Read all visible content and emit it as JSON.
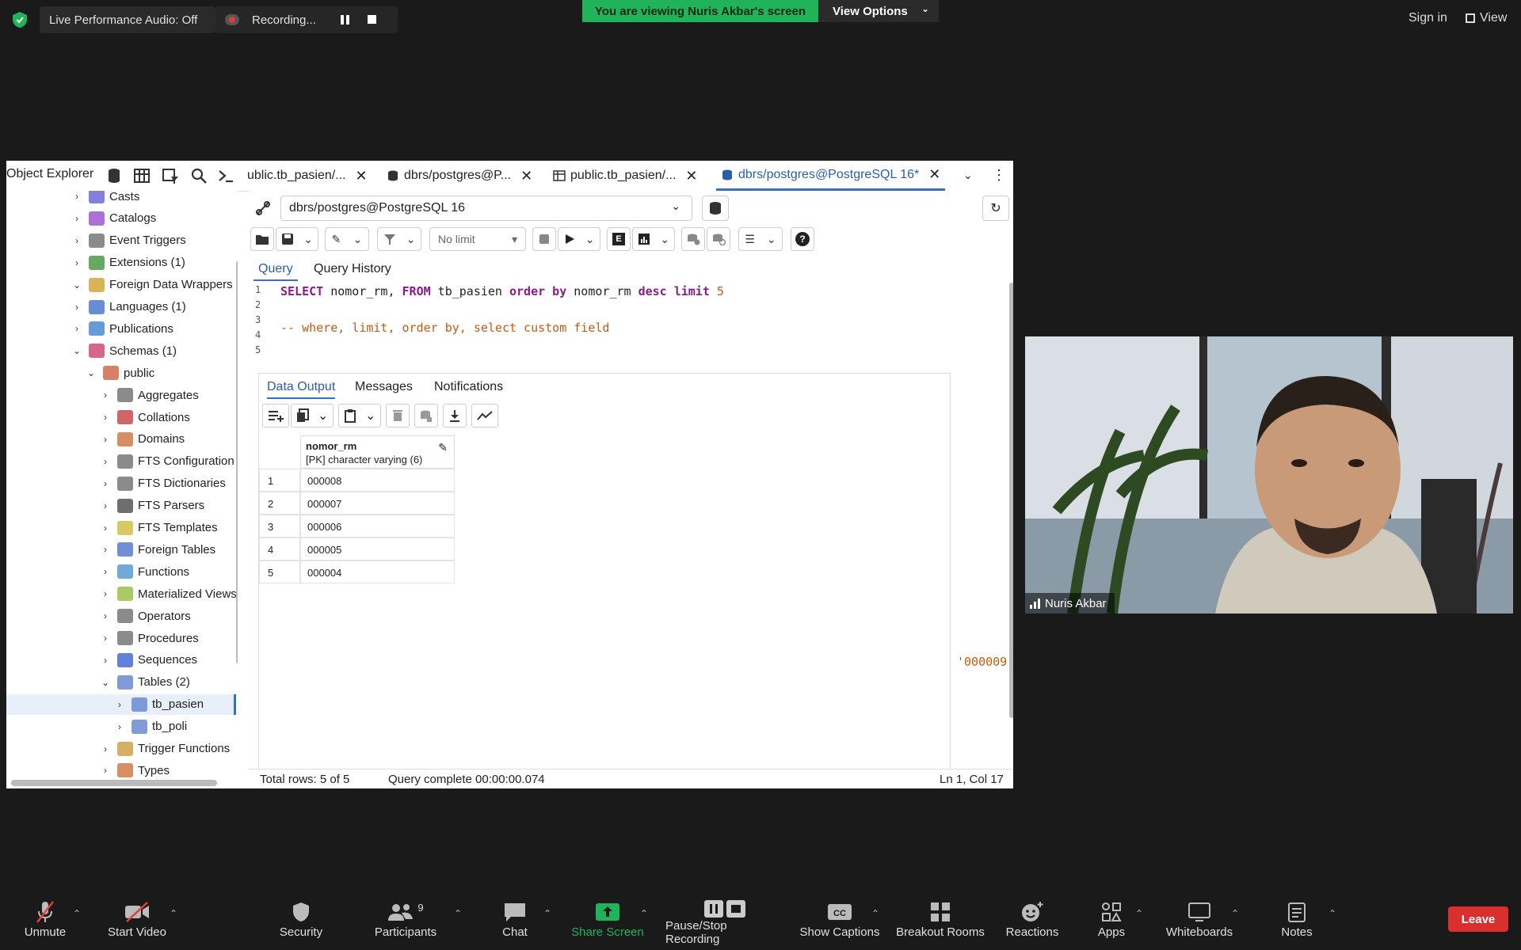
{
  "zoom_top": {
    "live_audio": "Live Performance Audio: Off",
    "recording": "Recording...",
    "banner": "You are viewing Nuris Akbar's screen",
    "view_options": "View Options",
    "sign_in": "Sign in",
    "view": "View"
  },
  "pgadmin": {
    "object_explorer": "Object Explorer",
    "tabs": [
      {
        "label": "ublic.tb_pasien/..."
      },
      {
        "label": "dbrs/postgres@P..."
      },
      {
        "label": "public.tb_pasien/..."
      },
      {
        "label": "dbrs/postgres@PostgreSQL 16*"
      }
    ],
    "tree": [
      {
        "label": "Casts"
      },
      {
        "label": "Catalogs"
      },
      {
        "label": "Event Triggers"
      },
      {
        "label": "Extensions (1)"
      },
      {
        "label": "Foreign Data Wrappers"
      },
      {
        "label": "Languages (1)"
      },
      {
        "label": "Publications"
      },
      {
        "label": "Schemas (1)"
      },
      {
        "label": "public"
      },
      {
        "label": "Aggregates"
      },
      {
        "label": "Collations"
      },
      {
        "label": "Domains"
      },
      {
        "label": "FTS Configuration"
      },
      {
        "label": "FTS Dictionaries"
      },
      {
        "label": "FTS Parsers"
      },
      {
        "label": "FTS Templates"
      },
      {
        "label": "Foreign Tables"
      },
      {
        "label": "Functions"
      },
      {
        "label": "Materialized Views"
      },
      {
        "label": "Operators"
      },
      {
        "label": "Procedures"
      },
      {
        "label": "Sequences"
      },
      {
        "label": "Tables (2)"
      },
      {
        "label": "tb_pasien"
      },
      {
        "label": "tb_poli"
      },
      {
        "label": "Trigger Functions"
      },
      {
        "label": "Types"
      }
    ],
    "connection": "dbrs/postgres@PostgreSQL 16",
    "limit": "No limit",
    "query_tab": "Query",
    "history_tab": "Query History",
    "code": {
      "l1_kw1": "SELECT",
      "l1_a": " nomor_rm, ",
      "l1_kw2": "FROM",
      "l1_b": " tb_pasien ",
      "l1_kw3": "order by",
      "l1_c": " nomor_rm ",
      "l1_kw4": "desc limit",
      "l1_num": " 5",
      "l3_comment": "-- where, limit, order by, select custom field",
      "trail_value": "'000009'"
    },
    "line_numbers": [
      "1",
      "2",
      "3",
      "4",
      "5"
    ],
    "results": {
      "tabs": [
        "Data Output",
        "Messages",
        "Notifications"
      ],
      "column": "nomor_rm",
      "column_type": "[PK] character varying (6)",
      "rows": [
        {
          "n": "1",
          "v": "000008"
        },
        {
          "n": "2",
          "v": "000007"
        },
        {
          "n": "3",
          "v": "000006"
        },
        {
          "n": "4",
          "v": "000005"
        },
        {
          "n": "5",
          "v": "000004"
        }
      ]
    },
    "status": {
      "total_rows": "Total rows: 5 of 5",
      "query_complete": "Query complete 00:00:00.074",
      "position": "Ln 1, Col 17"
    }
  },
  "video": {
    "name": "Nuris Akbar"
  },
  "bottom": {
    "unmute": "Unmute",
    "start_video": "Start Video",
    "security": "Security",
    "participants": "Participants",
    "participants_count": "9",
    "chat": "Chat",
    "share_screen": "Share Screen",
    "pause_stop": "Pause/Stop Recording",
    "captions": "Show Captions",
    "breakout": "Breakout Rooms",
    "reactions": "Reactions",
    "apps": "Apps",
    "whiteboards": "Whiteboards",
    "notes": "Notes",
    "leave": "Leave"
  }
}
